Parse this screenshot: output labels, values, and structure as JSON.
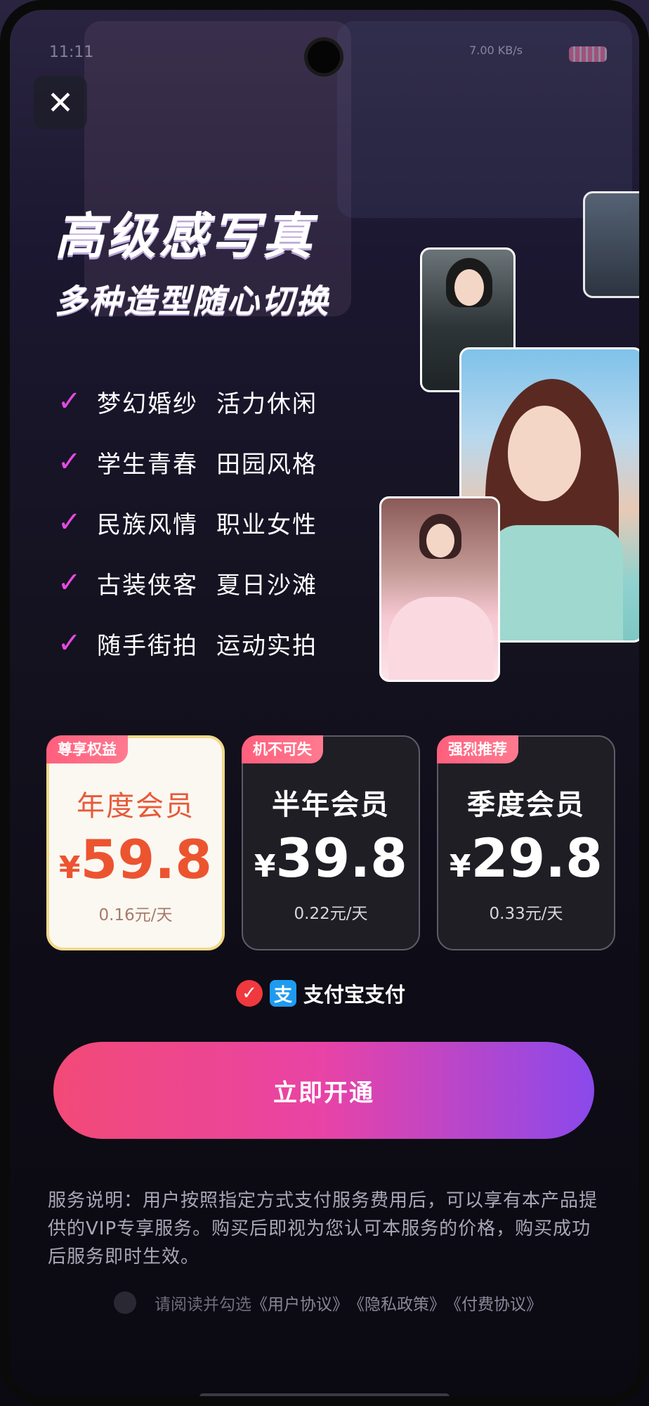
{
  "status_bar": {
    "time": "11:11",
    "network": "7.00 KB/s"
  },
  "hero": {
    "title": "高级感写真",
    "subtitle": "多种造型随心切换"
  },
  "features": [
    {
      "a": "梦幻婚纱",
      "b": "活力休闲"
    },
    {
      "a": "学生青春",
      "b": "田园风格"
    },
    {
      "a": "民族风情",
      "b": "职业女性"
    },
    {
      "a": "古装侠客",
      "b": "夏日沙滩"
    },
    {
      "a": "随手街拍",
      "b": "运动实拍"
    }
  ],
  "plans": [
    {
      "tag": "尊享权益",
      "name": "年度会员",
      "currency": "¥",
      "price": "59.8",
      "per_day": "0.16元/天",
      "selected": true
    },
    {
      "tag": "机不可失",
      "name": "半年会员",
      "currency": "¥",
      "price": "39.8",
      "per_day": "0.22元/天",
      "selected": false
    },
    {
      "tag": "强烈推荐",
      "name": "季度会员",
      "currency": "¥",
      "price": "29.8",
      "per_day": "0.33元/天",
      "selected": false
    }
  ],
  "payment": {
    "method": "支付宝支付",
    "checked": true
  },
  "cta": {
    "label": "立即开通"
  },
  "notice": "服务说明：用户按照指定方式支付服务费用后，可以享有本产品提供的VIP专享服务。购买后即视为您认可本服务的价格，购买成功后服务即时生效。",
  "agreement": {
    "prefix": "请阅读并勾选",
    "links": [
      "《用户协议》",
      "《隐私政策》",
      "《付费协议》"
    ]
  },
  "colors": {
    "accent_start": "#f24a77",
    "accent_end": "#8a49ec",
    "selected_price": "#ec5430",
    "check": "#e64ae0"
  },
  "icons": {
    "close": "close-icon",
    "check": "check-icon",
    "alipay": "alipay-icon"
  }
}
